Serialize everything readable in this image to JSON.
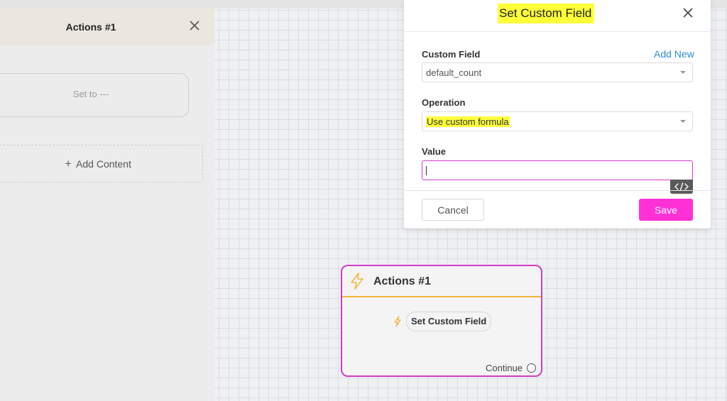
{
  "side_panel": {
    "title": "Actions #1",
    "set_to": "Set to ---",
    "add_content": "Add Content",
    "add_plus": "+"
  },
  "node": {
    "title": "Actions #1",
    "item_label": "Set Custom Field",
    "continue_label": "Continue"
  },
  "modal": {
    "title": "Set Custom Field",
    "custom_field": {
      "label": "Custom Field",
      "add_new": "Add New",
      "value": "default_count"
    },
    "operation": {
      "label": "Operation",
      "value": "Use custom formula"
    },
    "value_field": {
      "label": "Value",
      "value": ""
    },
    "cancel_label": "Cancel",
    "save_label": "Save"
  },
  "colors": {
    "accent": "#ff31d6",
    "node_border": "#d23dc8",
    "link": "#2d8fd5",
    "highlight": "#ffff3a",
    "node_divider": "#f2b43a"
  },
  "icons": {
    "close": "close-icon",
    "bolt": "lightning-bolt-icon",
    "code": "code-icon",
    "plus": "plus-icon"
  }
}
